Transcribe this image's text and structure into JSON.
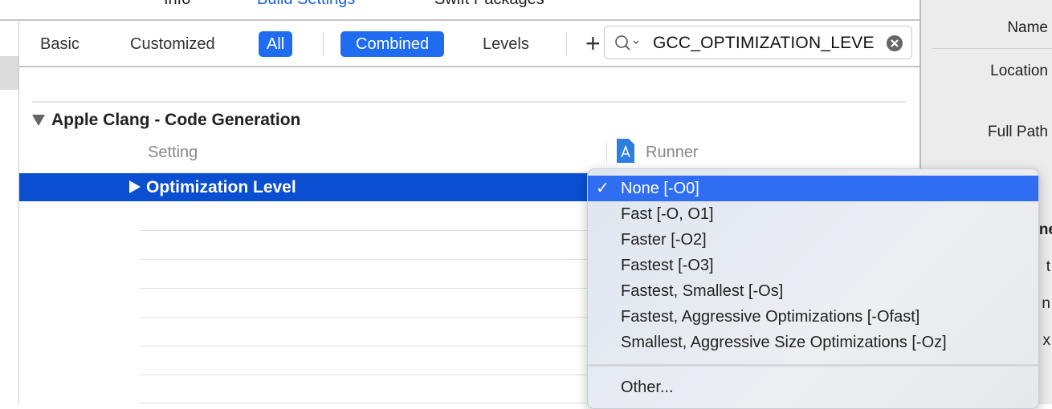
{
  "top_tabs": [
    {
      "label": "Info"
    },
    {
      "label": "Build Settings",
      "active": true
    },
    {
      "label": "Swift Packages"
    }
  ],
  "toolbar": {
    "filters": [
      {
        "label": "Basic"
      },
      {
        "label": "Customized"
      },
      {
        "label": "All",
        "active": true
      }
    ],
    "views": [
      {
        "label": "Combined",
        "active": true
      },
      {
        "label": "Levels"
      }
    ],
    "add_icon": "plus-icon",
    "search": {
      "value": "GCC_OPTIMIZATION_LEVE",
      "icon": "magnifier-dropdown-icon",
      "clear_icon": "clear-circle-icon"
    }
  },
  "section": {
    "title": "Apple Clang - Code Generation",
    "column_setting": "Setting",
    "column_target": "Runner",
    "target_icon": "app-target-icon"
  },
  "row": {
    "label": "Optimization Level",
    "selected": true
  },
  "menu": {
    "items": [
      {
        "label": "None [-O0]",
        "checked": true
      },
      {
        "label": "Fast [-O, O1]"
      },
      {
        "label": "Faster [-O2]"
      },
      {
        "label": "Fastest [-O3]"
      },
      {
        "label": "Fastest, Smallest [-Os]"
      },
      {
        "label": "Fastest, Aggressive Optimizations [-Ofast]"
      },
      {
        "label": "Smallest, Aggressive Size Optimizations [-Oz]"
      }
    ],
    "check": "✓",
    "other": "Other..."
  },
  "inspector": {
    "name": "Name",
    "location": "Location",
    "full_path": "Full Path",
    "partials": [
      "ne",
      "t",
      "n",
      "x"
    ]
  },
  "colors": {
    "accent": "#1f6cf0",
    "selected_row": "#0a4fd1",
    "menu_highlight": "#2f6ef0"
  }
}
